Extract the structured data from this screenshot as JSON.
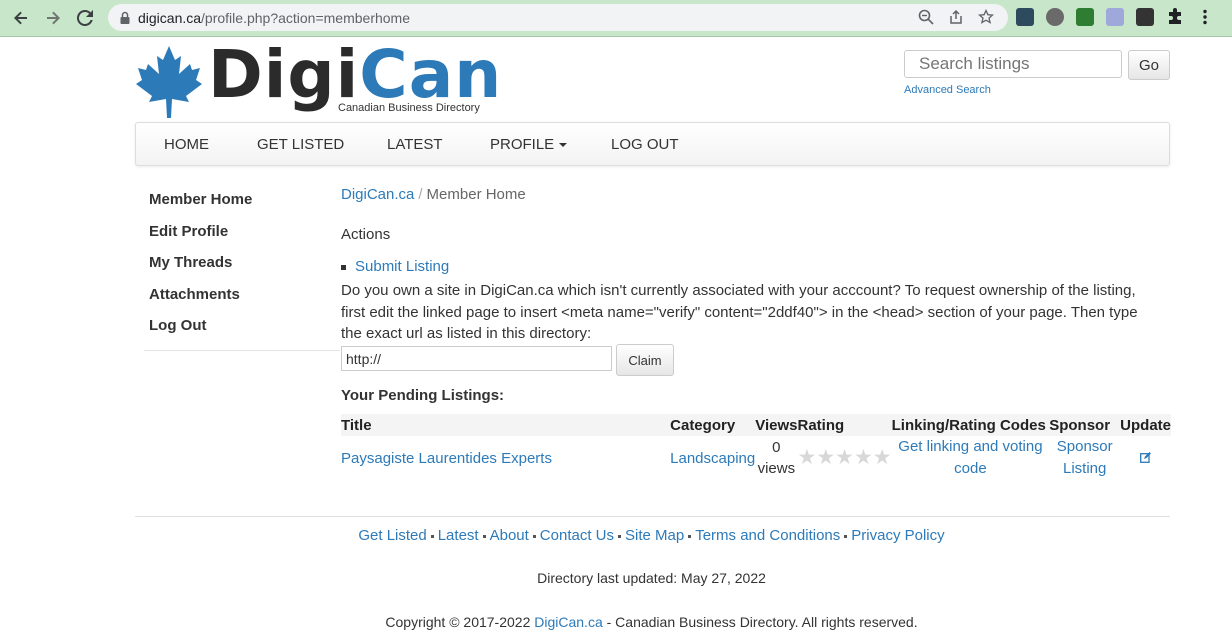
{
  "browser": {
    "url_host": "digican.ca",
    "url_path": "/profile.php?action=memberhome"
  },
  "brand": {
    "digi": "Digi",
    "can": "Can",
    "tagline": "Canadian Business Directory",
    "accent_color": "#2d7ab8"
  },
  "search": {
    "placeholder": "Search listings",
    "go_label": "Go",
    "advanced_label": "Advanced Search"
  },
  "nav": {
    "home": "HOME",
    "get_listed": "GET LISTED",
    "latest": "LATEST",
    "profile": "PROFILE",
    "logout": "LOG OUT"
  },
  "sidebar": {
    "items": [
      {
        "label": "Member Home"
      },
      {
        "label": "Edit Profile"
      },
      {
        "label": "My Threads"
      },
      {
        "label": "Attachments"
      },
      {
        "label": "Log Out"
      }
    ]
  },
  "breadcrumb": {
    "root": "DigiCan.ca",
    "sep": "/",
    "current": "Member Home"
  },
  "actions": {
    "heading": "Actions",
    "submit_listing": "Submit Listing",
    "claim_text": "Do you own a site in DigiCan.ca which isn't currently associated with your acccount? To request ownership of the listing, first edit the linked page to insert <meta name=\"verify\" content=\"2ddf40\"> in the <head> section of your page. Then type the exact url as listed in this directory:",
    "claim_input_value": "http://",
    "claim_button": "Claim"
  },
  "pending": {
    "heading": "Your Pending Listings:",
    "columns": {
      "title": "Title",
      "category": "Category",
      "views": "Views",
      "rating": "Rating",
      "codes": "Linking/Rating Codes",
      "sponsor": "Sponsor",
      "update": "Update"
    },
    "rows": [
      {
        "title": "Paysagiste Laurentides Experts",
        "category": "Landscaping",
        "views_count": "0",
        "views_unit": "views",
        "rating_stars": 0,
        "codes_link": "Get linking and voting code",
        "sponsor_link": "Sponsor Listing"
      }
    ]
  },
  "footer": {
    "links": [
      "Get Listed",
      "Latest",
      "About",
      "Contact Us",
      "Site Map",
      "Terms and Conditions",
      "Privacy Policy"
    ],
    "updated": "Directory last updated: May 27, 2022",
    "copyright_prefix": "Copyright © 2017-2022 ",
    "copyright_link": "DigiCan.ca",
    "copyright_suffix": " - Canadian Business Directory. All rights reserved."
  }
}
